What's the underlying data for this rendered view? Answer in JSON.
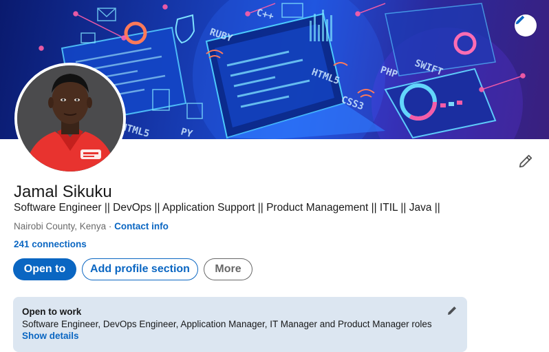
{
  "profile": {
    "name": "Jamal Sikuku",
    "headline": "Software Engineer || DevOps || Application Support || Product Management || ITIL || Java ||",
    "location": "Nairobi County, Kenya",
    "separator": "·",
    "contact_info": "Contact info",
    "connections": "241 connections"
  },
  "banner": {
    "tags": [
      "RUBY",
      "C++",
      "HTML5",
      "PHP",
      "SWIFT",
      "CSS3",
      "HTML5",
      "PY"
    ]
  },
  "actions": {
    "open_to": "Open to",
    "add_section": "Add profile section",
    "more": "More"
  },
  "open_to_work": {
    "title": "Open to work",
    "roles": "Software Engineer, DevOps Engineer, Application Manager, IT Manager and Product Manager roles",
    "show_details": "Show details"
  },
  "colors": {
    "brand_blue": "#0a66c2",
    "card_bg": "#dce6f1",
    "avatar_shirt": "#e8332f"
  },
  "icons": {
    "banner_edit": "pencil-icon",
    "intro_edit": "pencil-icon",
    "otw_edit": "pencil-icon"
  }
}
